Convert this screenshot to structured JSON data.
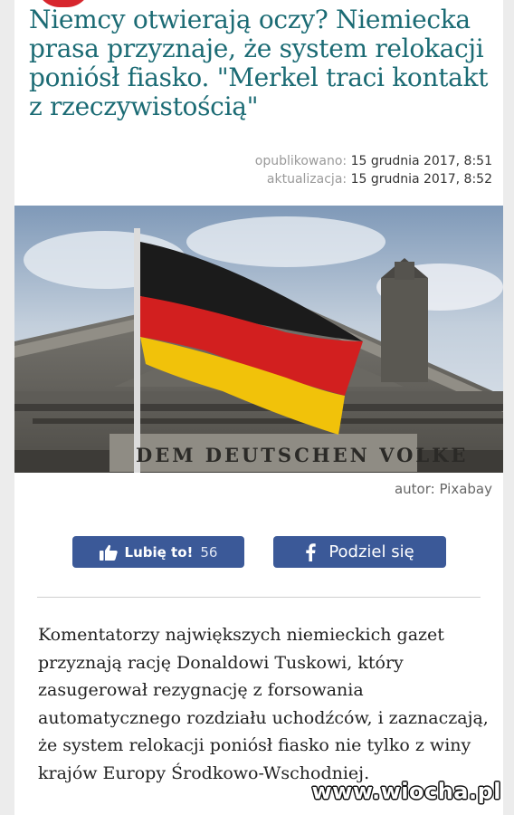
{
  "article": {
    "headline": "Niemcy otwierają oczy? Niemiecka prasa przyznaje, że system relokacji poniósł fiasko. \"Merkel traci kontakt z rzeczywistością\"",
    "published_label": "opublikowano:",
    "published_value": "15 grudnia 2017, 8:51",
    "updated_label": "aktualizacja:",
    "updated_value": "15 grudnia 2017, 8:52",
    "photo_inscription": "DEM DEUTSCHEN VOLKE",
    "photo_credit": "autor: Pixabay",
    "body": "Komentatorzy największych niemieckich gazet przyznają rację Donaldowi Tuskowi, który zasugerował rezygnację z forsowania automatycznego rozdziału uchodźców, i zaznaczają, że system relokacji poniósł fiasko nie tylko z winy krajów Europy Środkowo-Wschodniej."
  },
  "social": {
    "like_label": "Lubię to!",
    "like_count": "56",
    "share_label": "Podziel się"
  },
  "watermark": "www.wiocha.pl",
  "colors": {
    "headline": "#1b6b74",
    "facebook": "#3b5998",
    "badge": "#d7262d"
  },
  "icons": {
    "like": "thumbs-up-icon",
    "share": "facebook-f-icon"
  }
}
